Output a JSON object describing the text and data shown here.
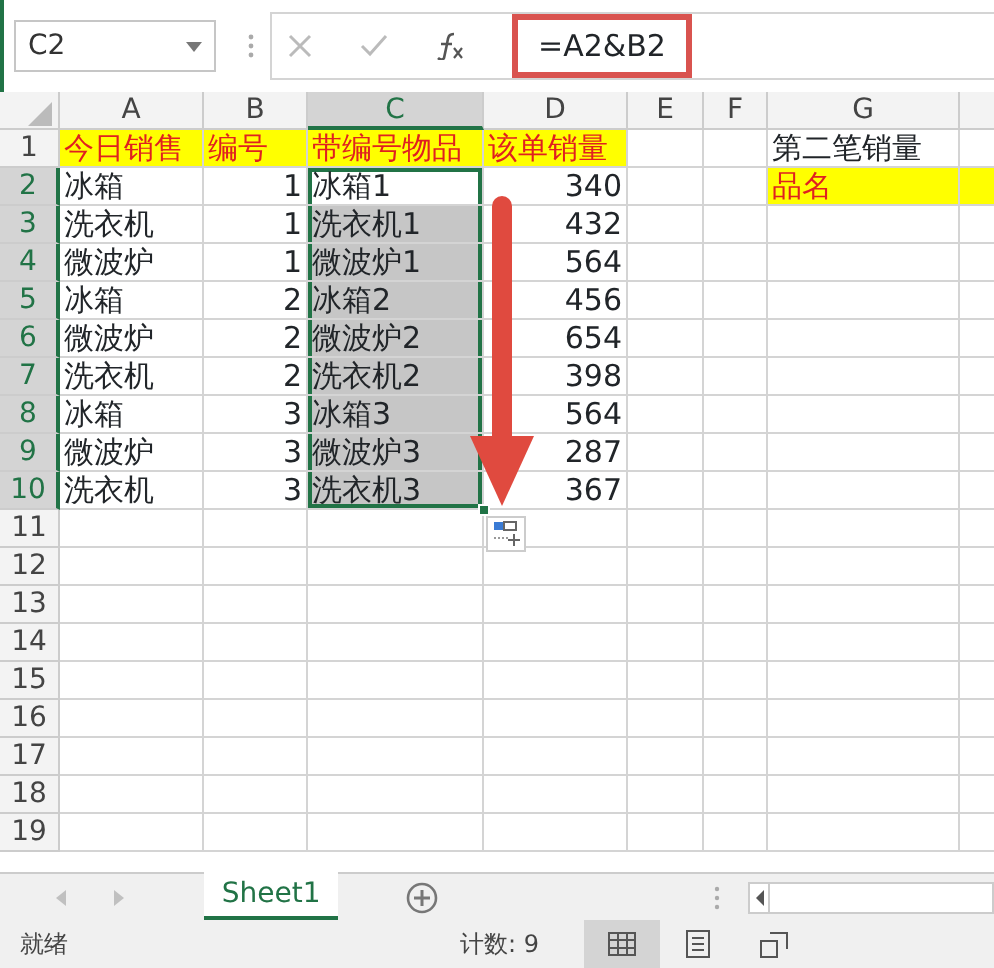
{
  "name_box": "C2",
  "formula_bar": {
    "value": "=A2&B2",
    "annotated": true
  },
  "columns": [
    {
      "label": "A",
      "selected": false
    },
    {
      "label": "B",
      "selected": false
    },
    {
      "label": "C",
      "selected": true
    },
    {
      "label": "D",
      "selected": false
    },
    {
      "label": "E",
      "selected": false
    },
    {
      "label": "F",
      "selected": false
    },
    {
      "label": "G",
      "selected": false
    }
  ],
  "rows": [
    {
      "number": "1",
      "selected": false,
      "cells": [
        {
          "kind": "header",
          "text": "今日销售"
        },
        {
          "kind": "header",
          "text": "编号"
        },
        {
          "kind": "header",
          "text": "带编号物品"
        },
        {
          "kind": "header",
          "text": "该单销量"
        },
        {
          "kind": "empty"
        },
        {
          "kind": "empty"
        },
        {
          "kind": "text",
          "text": "第二笔销量"
        }
      ]
    },
    {
      "number": "2",
      "selected": true,
      "cells": [
        {
          "kind": "text",
          "text": "冰箱"
        },
        {
          "kind": "number",
          "text": "1"
        },
        {
          "kind": "text",
          "text": "冰箱1"
        },
        {
          "kind": "number",
          "text": "340"
        },
        {
          "kind": "empty"
        },
        {
          "kind": "empty"
        },
        {
          "kind": "header",
          "text": "品名"
        },
        {
          "kind": "fill"
        }
      ]
    },
    {
      "number": "3",
      "selected": true,
      "cells": [
        {
          "kind": "text",
          "text": "洗衣机"
        },
        {
          "kind": "number",
          "text": "1"
        },
        {
          "kind": "text",
          "text": "洗衣机1"
        },
        {
          "kind": "number",
          "text": "432"
        }
      ]
    },
    {
      "number": "4",
      "selected": true,
      "cells": [
        {
          "kind": "text",
          "text": "微波炉"
        },
        {
          "kind": "number",
          "text": "1"
        },
        {
          "kind": "text",
          "text": "微波炉1"
        },
        {
          "kind": "number",
          "text": "564"
        }
      ]
    },
    {
      "number": "5",
      "selected": true,
      "cells": [
        {
          "kind": "text",
          "text": "冰箱"
        },
        {
          "kind": "number",
          "text": "2"
        },
        {
          "kind": "text",
          "text": "冰箱2"
        },
        {
          "kind": "number",
          "text": "456"
        }
      ]
    },
    {
      "number": "6",
      "selected": true,
      "cells": [
        {
          "kind": "text",
          "text": "微波炉"
        },
        {
          "kind": "number",
          "text": "2"
        },
        {
          "kind": "text",
          "text": "微波炉2"
        },
        {
          "kind": "number",
          "text": "654"
        }
      ]
    },
    {
      "number": "7",
      "selected": true,
      "cells": [
        {
          "kind": "text",
          "text": "洗衣机"
        },
        {
          "kind": "number",
          "text": "2"
        },
        {
          "kind": "text",
          "text": "洗衣机2"
        },
        {
          "kind": "number",
          "text": "398"
        }
      ]
    },
    {
      "number": "8",
      "selected": true,
      "cells": [
        {
          "kind": "text",
          "text": "冰箱"
        },
        {
          "kind": "number",
          "text": "3"
        },
        {
          "kind": "text",
          "text": "冰箱3"
        },
        {
          "kind": "number",
          "text": "564"
        }
      ]
    },
    {
      "number": "9",
      "selected": true,
      "cells": [
        {
          "kind": "text",
          "text": "微波炉"
        },
        {
          "kind": "number",
          "text": "3"
        },
        {
          "kind": "text",
          "text": "微波炉3"
        },
        {
          "kind": "number",
          "text": "287"
        }
      ]
    },
    {
      "number": "10",
      "selected": true,
      "cells": [
        {
          "kind": "text",
          "text": "洗衣机"
        },
        {
          "kind": "number",
          "text": "3"
        },
        {
          "kind": "text",
          "text": "洗衣机3"
        },
        {
          "kind": "number",
          "text": "367"
        }
      ]
    },
    {
      "number": "11",
      "selected": false
    },
    {
      "number": "12",
      "selected": false
    },
    {
      "number": "13",
      "selected": false
    },
    {
      "number": "14",
      "selected": false
    },
    {
      "number": "15",
      "selected": false
    },
    {
      "number": "16",
      "selected": false
    },
    {
      "number": "17",
      "selected": false
    },
    {
      "number": "18",
      "selected": false
    },
    {
      "number": "19",
      "selected": false
    }
  ],
  "fill_arrow": true,
  "sheet_tabs": [
    {
      "label": "Sheet1",
      "selected": true
    }
  ],
  "status_bar": {
    "status": "就绪",
    "count": "计数: 9",
    "views": [
      {
        "kind": "normal",
        "selected": true
      },
      {
        "kind": "layout",
        "selected": false
      },
      {
        "kind": "break",
        "selected": false
      }
    ]
  }
}
